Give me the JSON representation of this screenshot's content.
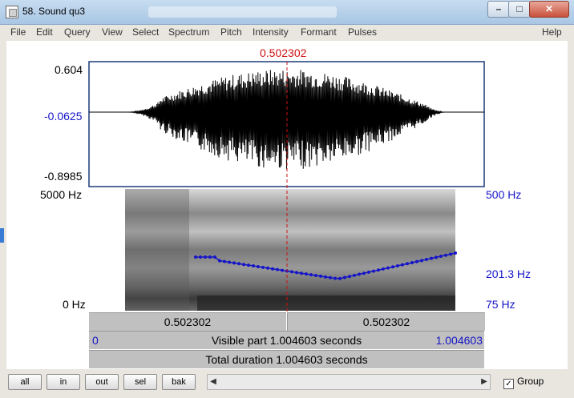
{
  "window": {
    "title": "58. Sound qu3"
  },
  "menu": [
    "File",
    "Edit",
    "Query",
    "View",
    "Select",
    "Spectrum",
    "Pitch",
    "Intensity",
    "Formant",
    "Pulses"
  ],
  "help": "Help",
  "cursor": {
    "time": "0.502302"
  },
  "waveform": {
    "max": "0.604",
    "zero": "-0.0625",
    "min": "-0.8985"
  },
  "spectrogram": {
    "freq_max": "5000 Hz",
    "freq_min": "0 Hz",
    "pitch_max": "500 Hz",
    "pitch_value": "201.3 Hz",
    "pitch_min": "75 Hz"
  },
  "bars": {
    "left_segment": "0.502302",
    "right_segment": "0.502302",
    "visible_start": "0",
    "visible_part": "Visible part 1.004603 seconds",
    "visible_end": "1.004603",
    "total": "Total duration 1.004603 seconds"
  },
  "buttons": {
    "all": "all",
    "in": "in",
    "out": "out",
    "sel": "sel",
    "bak": "bak"
  },
  "group": {
    "label": "Group",
    "checked": "✓"
  },
  "colors": {
    "pitch": "#1515c8",
    "cursor": "#d01010"
  }
}
